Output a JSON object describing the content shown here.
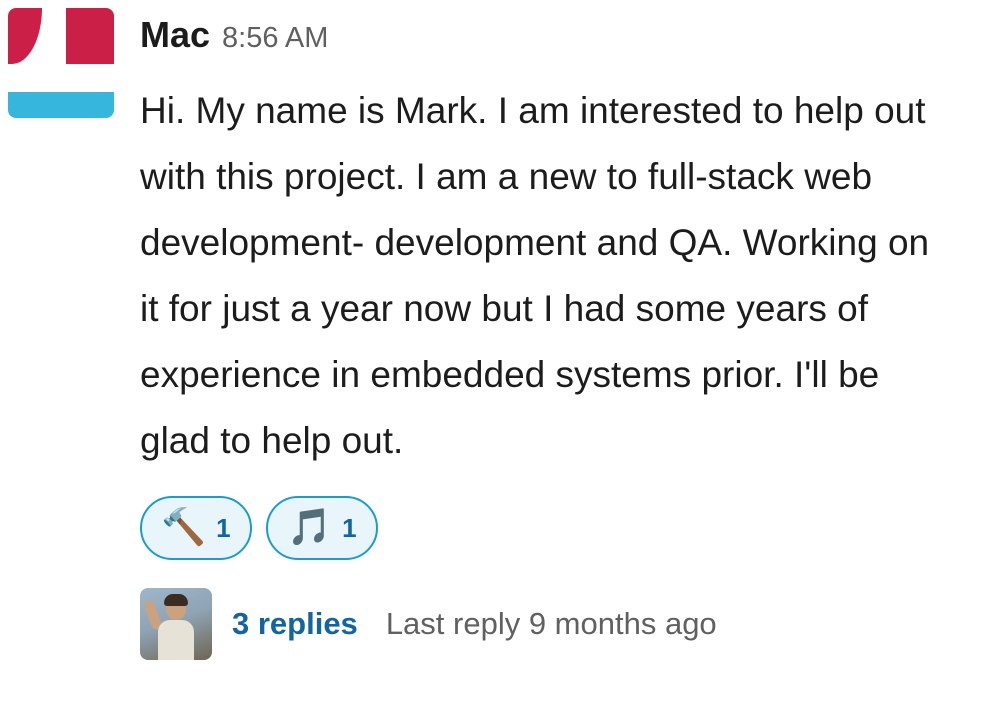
{
  "message": {
    "sender": "Mac",
    "timestamp": "8:56 AM",
    "text": "Hi. My name is Mark. I am interested to help out with this project. I am a new to full-stack web development- development and QA. Working on it for just a year now but I had some years of experience in embedded systems prior. I'll be glad to help out.",
    "avatar_colors": {
      "top": "#cc1f48",
      "bottom": "#36b5dd"
    }
  },
  "reactions": [
    {
      "emoji": "🔨",
      "icon": "hammer-icon",
      "count": "1"
    },
    {
      "emoji": "🎵",
      "icon": "musical-note-icon",
      "count": "1"
    }
  ],
  "thread": {
    "replies_label": "3 replies",
    "last_reply_label": "Last reply 9 months ago"
  },
  "colors": {
    "link": "#1264a3",
    "reaction_border": "#1d9bd1",
    "reaction_bg": "#e8f5fa",
    "muted_text": "#616061"
  }
}
